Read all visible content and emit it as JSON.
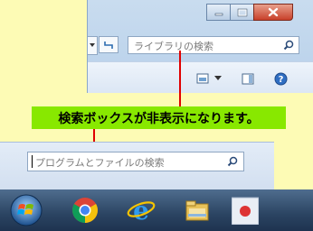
{
  "explorer": {
    "search_placeholder": "ライブラリの検索"
  },
  "callout": {
    "text": "検索ボックスが非表示になります。"
  },
  "start_menu": {
    "search_placeholder": "プログラムとファイルの検索"
  },
  "taskbar": {
    "icons": [
      "windows-start-icon",
      "chrome-icon",
      "internet-explorer-icon",
      "file-explorer-icon",
      "media-icon"
    ]
  },
  "colors": {
    "background": "#fdfbb5",
    "callout": "#88e800",
    "leader_line": "#e00000",
    "close_button": "#c8402a"
  }
}
